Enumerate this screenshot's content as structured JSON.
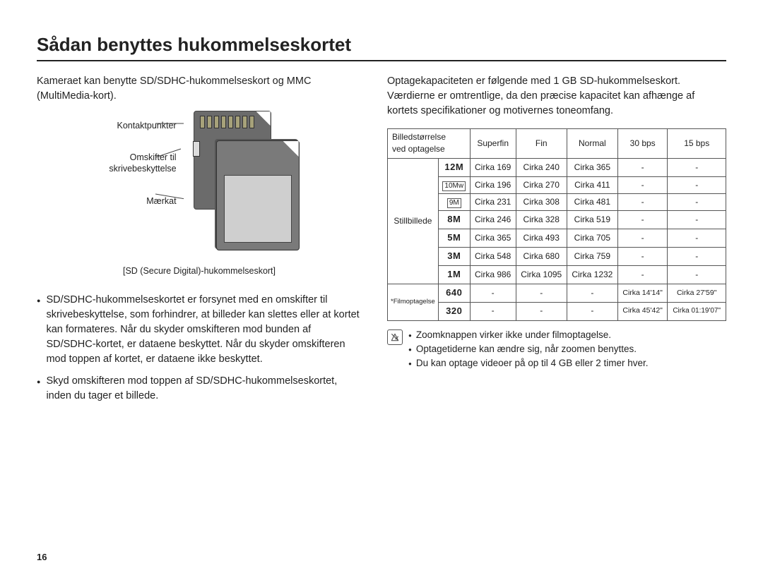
{
  "title": "Sådan benyttes hukommelseskortet",
  "left": {
    "intro": "Kameraet kan benytte SD/SDHC-hukommelseskort og MMC (MultiMedia-kort).",
    "labels": {
      "contacts": "Kontaktpunkter",
      "wp_line1": "Omskifter til",
      "wp_line2": "skrivebeskyttelse",
      "label": "Mærkat"
    },
    "caption": "[SD (Secure Digital)-hukommelseskort]",
    "bullets": [
      "SD/SDHC-hukommelseskortet er forsynet med en omskifter til skrivebeskyttelse, som forhindrer, at billeder kan slettes eller at kortet kan formateres. Når du skyder omskifteren mod bunden af SD/SDHC-kortet, er dataene beskyttet. Når du skyder omskifteren mod toppen af kortet, er dataene ikke beskyttet.",
      "Skyd omskifteren mod toppen af SD/SDHC-hukommelseskortet, inden du tager et billede."
    ]
  },
  "right": {
    "intro": "Optagekapaciteten er følgende med 1 GB SD-hukommelseskort. Værdierne er omtrentlige, da den præcise kapacitet kan afhænge af kortets specifikationer og motivernes toneomfang.",
    "table": {
      "header": {
        "corner_l1": "Billedstørrelse",
        "corner_l2": "ved optagelse",
        "cols": [
          "Superfin",
          "Fin",
          "Normal",
          "30 bps",
          "15 bps"
        ]
      },
      "group_still": "Stillbillede",
      "group_movie": "*Filmoptagelse",
      "rows_still": [
        {
          "size": "12M",
          "vals": [
            "Cirka 169",
            "Cirka 240",
            "Cirka 365",
            "-",
            "-"
          ]
        },
        {
          "size": "10Mw",
          "vals": [
            "Cirka 196",
            "Cirka 270",
            "Cirka 411",
            "-",
            "-"
          ]
        },
        {
          "size": "9M",
          "vals": [
            "Cirka 231",
            "Cirka 308",
            "Cirka 481",
            "-",
            "-"
          ]
        },
        {
          "size": "8M",
          "vals": [
            "Cirka 246",
            "Cirka 328",
            "Cirka 519",
            "-",
            "-"
          ]
        },
        {
          "size": "5M",
          "vals": [
            "Cirka 365",
            "Cirka 493",
            "Cirka 705",
            "-",
            "-"
          ]
        },
        {
          "size": "3M",
          "vals": [
            "Cirka 548",
            "Cirka 680",
            "Cirka 759",
            "-",
            "-"
          ]
        },
        {
          "size": "1M",
          "vals": [
            "Cirka 986",
            "Cirka 1095",
            "Cirka 1232",
            "-",
            "-"
          ]
        }
      ],
      "rows_movie": [
        {
          "size": "640",
          "vals": [
            "-",
            "-",
            "-",
            "Cirka 14'14\"",
            "Cirka 27'59\""
          ]
        },
        {
          "size": "320",
          "vals": [
            "-",
            "-",
            "-",
            "Cirka 45'42\"",
            "Cirka 01:19'07\""
          ]
        }
      ]
    },
    "notes": [
      "Zoomknappen virker ikke under filmoptagelse.",
      "Optagetiderne kan ændre sig, når zoomen benyttes.",
      "Du kan optage videoer på op til 4 GB eller 2 timer hver."
    ]
  },
  "page_number": "16"
}
